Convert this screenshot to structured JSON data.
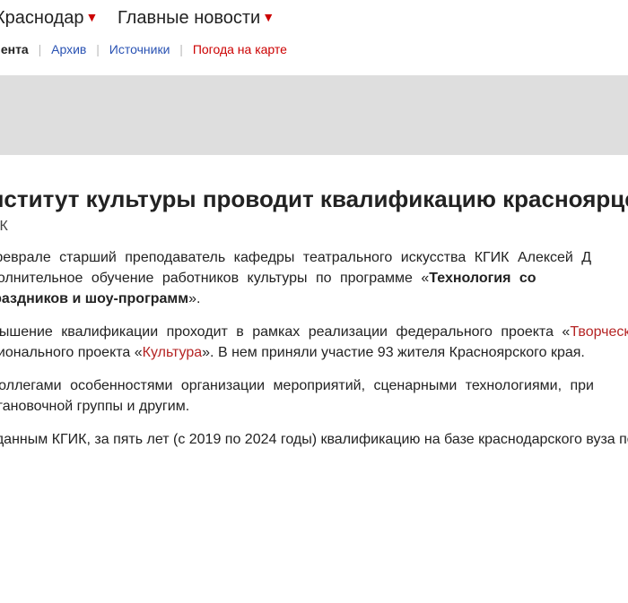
{
  "nav": {
    "region": "Краснодар",
    "section": "Главные новости",
    "dropdown_glyph": "▼"
  },
  "subnav": {
    "feed": "Лента",
    "archive": "Архив",
    "sources": "Источники",
    "weather": "Погода на карте",
    "separator": "|"
  },
  "article": {
    "title": "Институт культуры проводит квалификацию красноярцев",
    "source": "КГИК",
    "p1": {
      "l1": "В феврале старший преподаватель кафедры театрального искусства КГИК Алексей Д",
      "l2_text": "дополнительное обучение работников культуры по программе «",
      "l2_bold": "Технология со",
      "l3_bold": "к праздников и шоу-программ",
      "l3_end": "»."
    },
    "p2": {
      "l1_text": "Повышение квалификации проходит в рамках реализации федерального проекта «",
      "l1_link": "Творческие",
      "l2_text": "национального проекта «",
      "l2_link": "Культура",
      "l2_end": "». В нем приняли участие 93 жителя Красноярского края."
    },
    "p3": {
      "l1": "С коллегами  особенностями организации мероприятий, сценарными технологиями, при",
      "l2": "постановочной группы и другим."
    },
    "p4": {
      "l1": "По данным КГИК, за пять лет (с 2019 по 2024 годы) квалификацию на базе краснодарского вуза пов"
    }
  },
  "colors": {
    "accent_red": "#cc0000",
    "link_blue": "#2952b3",
    "banner_gray": "#dedede"
  }
}
